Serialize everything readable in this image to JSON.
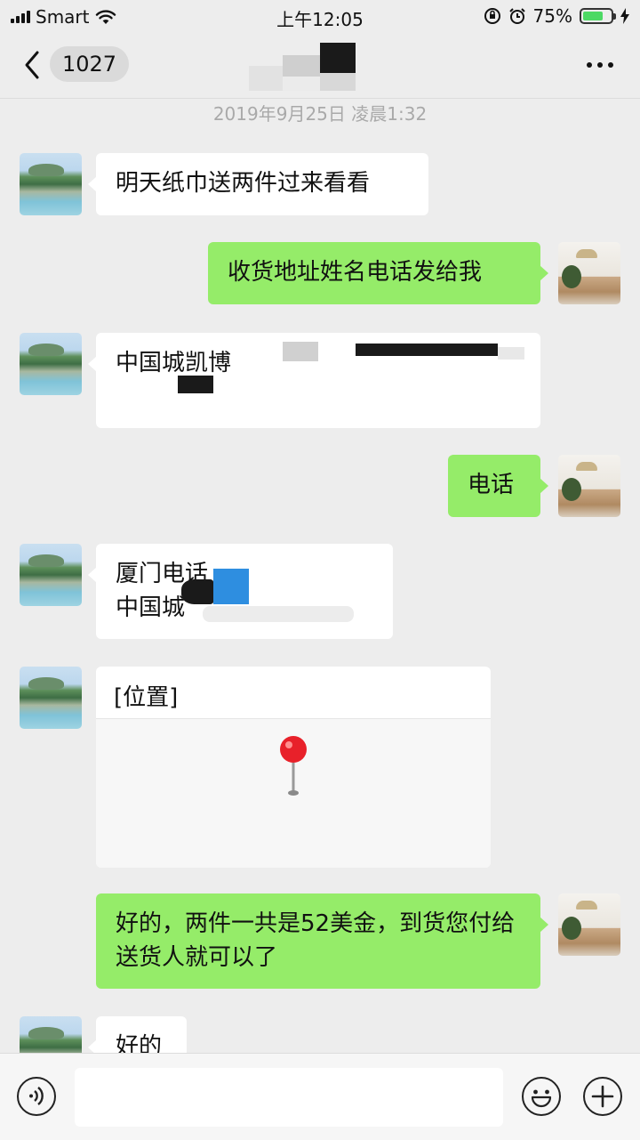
{
  "status_bar": {
    "carrier": "Smart",
    "time": "上午12:05",
    "battery_percent": "75%",
    "battery_level": 0.75
  },
  "nav": {
    "unread_count": "1027",
    "title": ""
  },
  "chat": {
    "timestamp": "2019年9月25日 凌晨1:32",
    "messages": [
      {
        "side": "left",
        "text": "明天纸巾送两件过来看看"
      },
      {
        "side": "right",
        "text": "收货地址姓名电话发给我"
      },
      {
        "side": "left",
        "text": "中国城凯博"
      },
      {
        "side": "right",
        "text": "电话"
      },
      {
        "side": "left",
        "line1": "厦门电话",
        "line2": "中国城"
      },
      {
        "side": "left",
        "type": "location",
        "text": "[位置]"
      },
      {
        "side": "right",
        "text": "好的，两件一共是52美金，到货您付给送货人就可以了"
      },
      {
        "side": "left",
        "text": "好的"
      }
    ]
  },
  "input_bar": {
    "value": "",
    "placeholder": ""
  },
  "colors": {
    "background": "#ededed",
    "sent_bubble": "#95ec69",
    "received_bubble": "#ffffff",
    "battery_fill": "#4cd964",
    "pin": "#e8212a"
  },
  "icons": [
    "signal-icon",
    "wifi-icon",
    "orientation-lock-icon",
    "alarm-icon",
    "battery-icon",
    "charging-icon",
    "back-arrow-icon",
    "more-icon",
    "voice-icon",
    "emoji-icon",
    "plus-icon",
    "location-pin-icon"
  ]
}
